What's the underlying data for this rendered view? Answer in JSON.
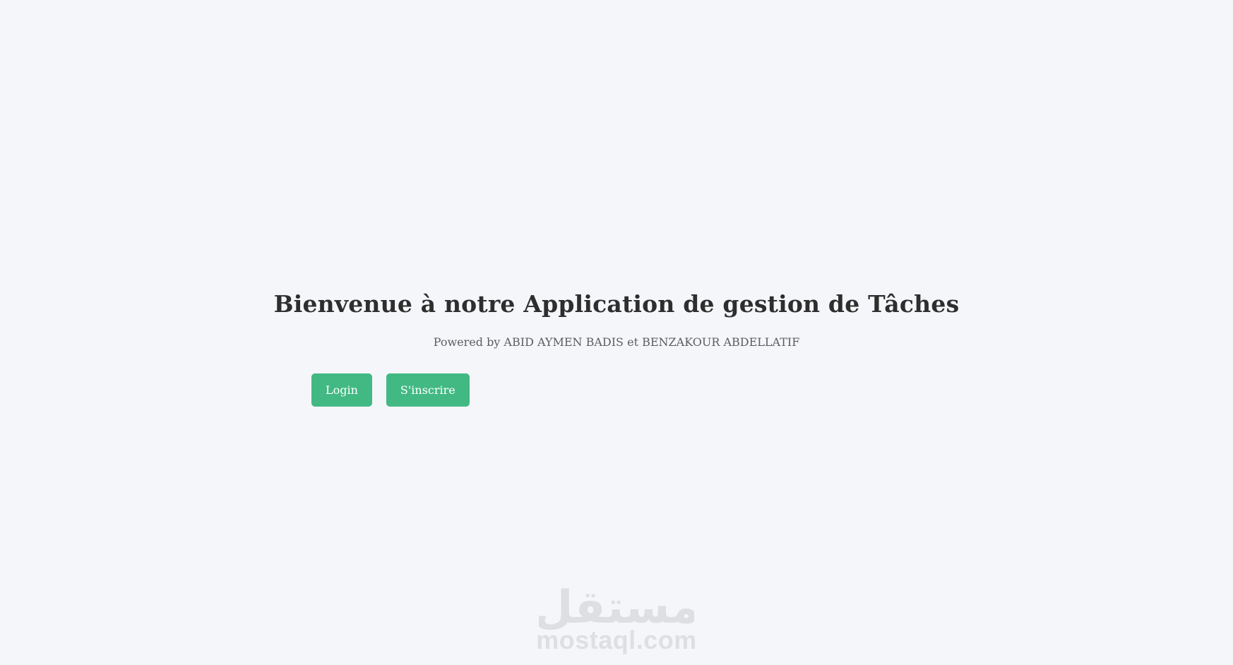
{
  "hero": {
    "title": "Bienvenue à notre Application de gestion de Tâches",
    "subtitle": "Powered by ABID AYMEN BADIS et BENZAKOUR ABDELLATIF"
  },
  "actions": {
    "login_label": "Login",
    "register_label": "S'inscrire"
  },
  "watermark": {
    "arabic_text": "مستقل",
    "text": "mostaql.com"
  },
  "colors": {
    "background": "#f5f6fa",
    "button": "#42b983",
    "button_text": "#ffffff",
    "title": "#2e2e2e",
    "subtitle": "#5d5d5d",
    "watermark": "#dcdde0"
  }
}
